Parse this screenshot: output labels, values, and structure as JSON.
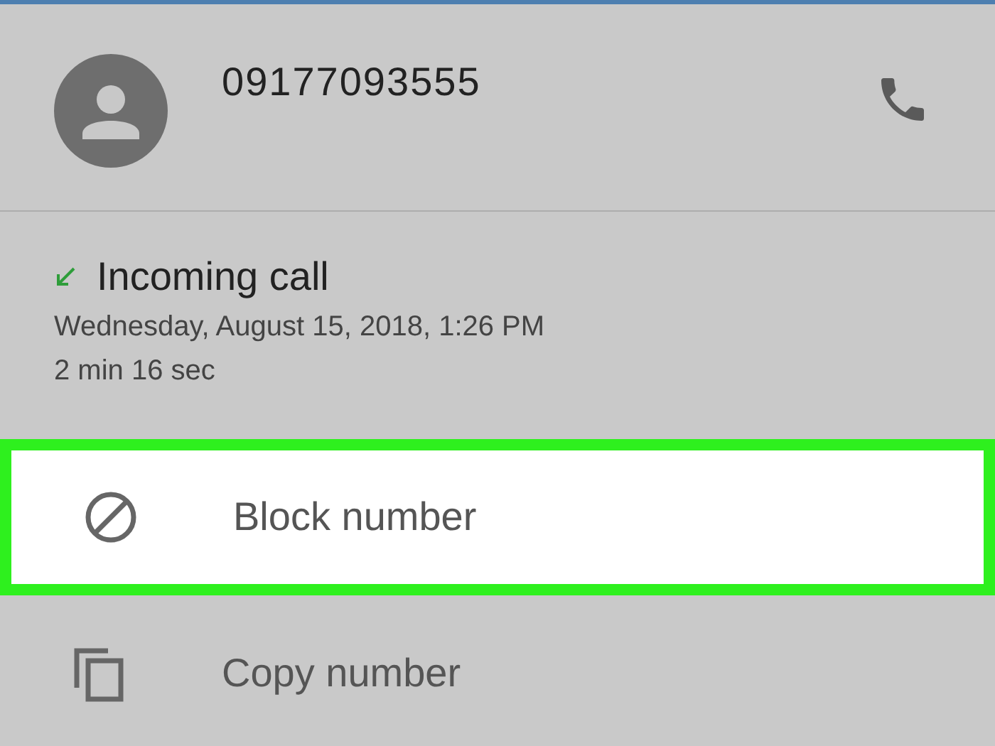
{
  "contact": {
    "number": "09177093555"
  },
  "call": {
    "type": "Incoming call",
    "date": "Wednesday, August 15, 2018, 1:26 PM",
    "duration": "2 min 16 sec"
  },
  "actions": [
    {
      "kind": "block",
      "label": "Block number",
      "highlighted": true
    },
    {
      "kind": "copy",
      "label": "Copy number",
      "highlighted": false
    }
  ]
}
